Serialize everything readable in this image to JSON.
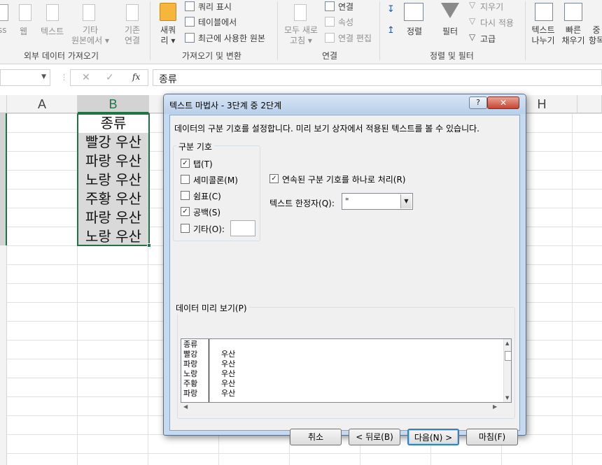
{
  "ribbon": {
    "ext_data": {
      "ss": "ss",
      "web": "웹",
      "text": "텍스트",
      "other": "기타",
      "other2": "원본에서 ▾",
      "existing": "기존",
      "existing2": "연결",
      "group_label": "외부 데이터 가져오기"
    },
    "transform": {
      "new_query": "새쿼",
      "new_query2": "리 ▾",
      "show_query": "쿼리 표시",
      "from_table": "테이블에서",
      "recent_sources": "최근에 사용한 원본",
      "group_label": "가져오기 및 변환"
    },
    "connections": {
      "refresh_all": "모두 새로",
      "refresh_all2": "고침 ▾",
      "connections": "연결",
      "properties": "속성",
      "edit_links": "연결 편집",
      "group_label": "연결"
    },
    "sort_filter": {
      "sort": "정렬",
      "filter": "필터",
      "clear": "지우기",
      "reapply": "다시 적용",
      "advanced": "고급",
      "group_label": "정렬 및 필터"
    },
    "data_tools": {
      "text_to_columns": "텍스트",
      "text_to_columns2": "나누기",
      "flash_fill": "빠른",
      "flash_fill2": "채우기",
      "remove_dup": "중",
      "remove_dup2": "항목"
    }
  },
  "formula_bar": {
    "name_box_value": "",
    "cancel": "✕",
    "enter": "✓",
    "fx": "fx",
    "content": "종류"
  },
  "grid": {
    "columns": [
      "A",
      "B",
      "H"
    ],
    "cells": [
      "종류",
      "빨강 우산",
      "파랑 우산",
      "노랑 우산",
      "주황 우산",
      "파랑 우산",
      "노랑 우산"
    ]
  },
  "dialog": {
    "title": "텍스트 마법사 - 3단계 중 2단계",
    "help": "?",
    "close": "✕",
    "description": "데이터의 구분 기호를 설정합니다. 미리 보기 상자에서 적용된 텍스트를 볼 수 있습니다.",
    "delimiters_legend": "구분 기호",
    "delimiters": [
      {
        "label": "탭(T)",
        "checked": true
      },
      {
        "label": "세미콜론(M)",
        "checked": false
      },
      {
        "label": "쉼표(C)",
        "checked": false
      },
      {
        "label": "공백(S)",
        "checked": true
      },
      {
        "label": "기타(O):",
        "checked": false
      }
    ],
    "other_value": "",
    "consecutive_label": "연속된 구분 기호를 하나로 처리(R)",
    "consecutive_checked": true,
    "qualifier_label": "텍스트 한정자(Q):",
    "qualifier_value": "\"",
    "preview_label": "데이터 미리 보기(P)",
    "preview_rows": [
      [
        "종류",
        ""
      ],
      [
        "빨강",
        "우산"
      ],
      [
        "파랑",
        "우산"
      ],
      [
        "노랑",
        "우산"
      ],
      [
        "주황",
        "우산"
      ],
      [
        "파랑",
        "우산"
      ]
    ],
    "buttons": {
      "cancel": "취소",
      "back": "< 뒤로(B)",
      "next": "다음(N) >",
      "finish": "마침(F)"
    }
  },
  "colors": {
    "excel_green": "#217346",
    "selection_shade": "#d9d9d9",
    "dialog_frame": "#c5d9f1"
  }
}
